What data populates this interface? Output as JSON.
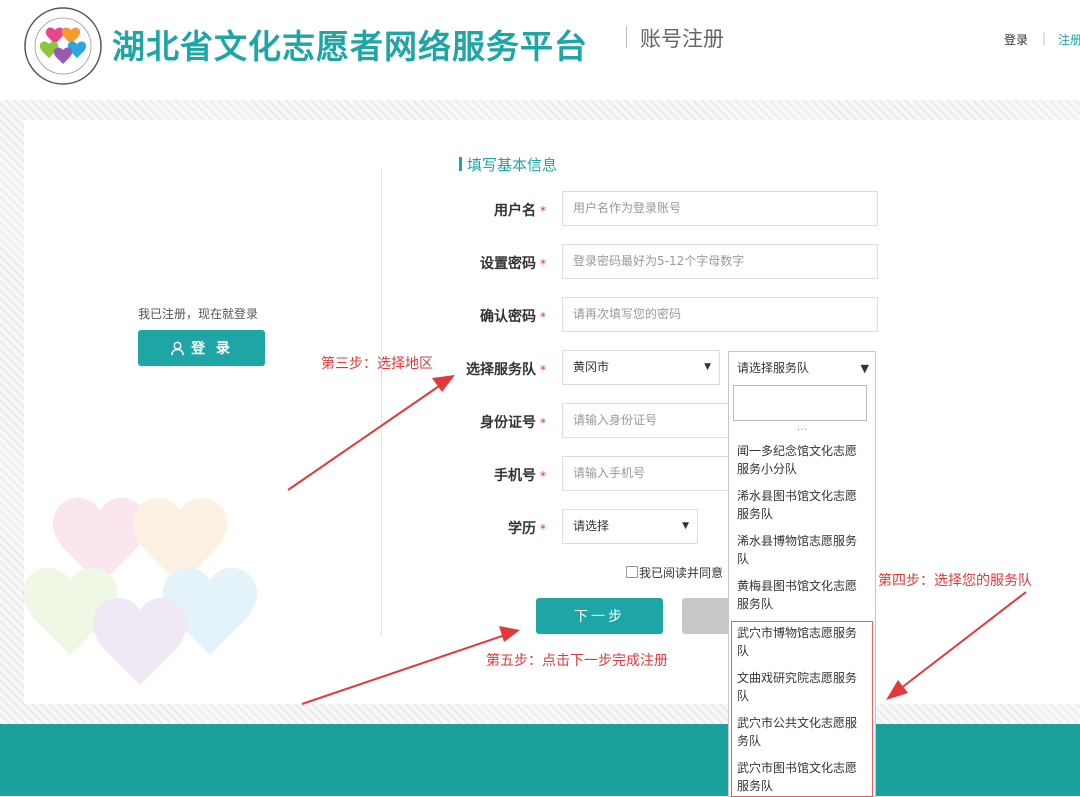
{
  "header": {
    "site_title": "湖北省文化志愿者网络服务平台",
    "page_subtitle": "账号注册",
    "login_link": "登录",
    "link_separator": "|",
    "register_link": "注册",
    "logo_icon": "volunteer-hearts-logo-icon",
    "logo_ring_text": "CHINA CULTURAL SERVICE VOLUNTEERS",
    "logo_inner_text": "中国文化志愿者"
  },
  "left_panel": {
    "already_text": "我已注册，现在就登录",
    "login_button": "登 录",
    "login_icon": "user-icon"
  },
  "form": {
    "section_title": "填写基本信息",
    "required_mark": "*",
    "username_label": "用户名",
    "username_placeholder": "用户名作为登录账号",
    "password_label": "设置密码",
    "password_placeholder": "登录密码最好为5-12个字母数字",
    "confirm_label": "确认密码",
    "confirm_placeholder": "请再次填写您的密码",
    "team_label": "选择服务队",
    "region_value": "黄冈市",
    "team_placeholder": "请选择服务队",
    "id_label": "身份证号",
    "id_placeholder": "请输入身份证号",
    "phone_label": "手机号",
    "phone_placeholder": "请输入手机号",
    "edu_label": "学历",
    "edu_value": "请选择",
    "agree_text": "我已阅读并同意",
    "next_button": "下一步"
  },
  "dropdown": {
    "more": "...",
    "items": [
      "闻一多纪念馆文化志愿服务小分队",
      "浠水县图书馆文化志愿服务队",
      "浠水县博物馆志愿服务队",
      "黄梅县图书馆文化志愿服务队",
      "武穴市博物馆志愿服务队",
      "文曲戏研究院志愿服务队",
      "武穴市公共文化志愿服务队",
      "武穴市图书馆文化志愿服务队"
    ]
  },
  "annotations": {
    "step3": "第三步：选择地区",
    "step4": "第四步：选择您的服务队",
    "step5": "第五步：点击下一步完成注册",
    "color": "#e3393a"
  },
  "colors": {
    "brand": "#1ea6a6",
    "footer": "#1aa19e",
    "required": "#e0392f"
  }
}
